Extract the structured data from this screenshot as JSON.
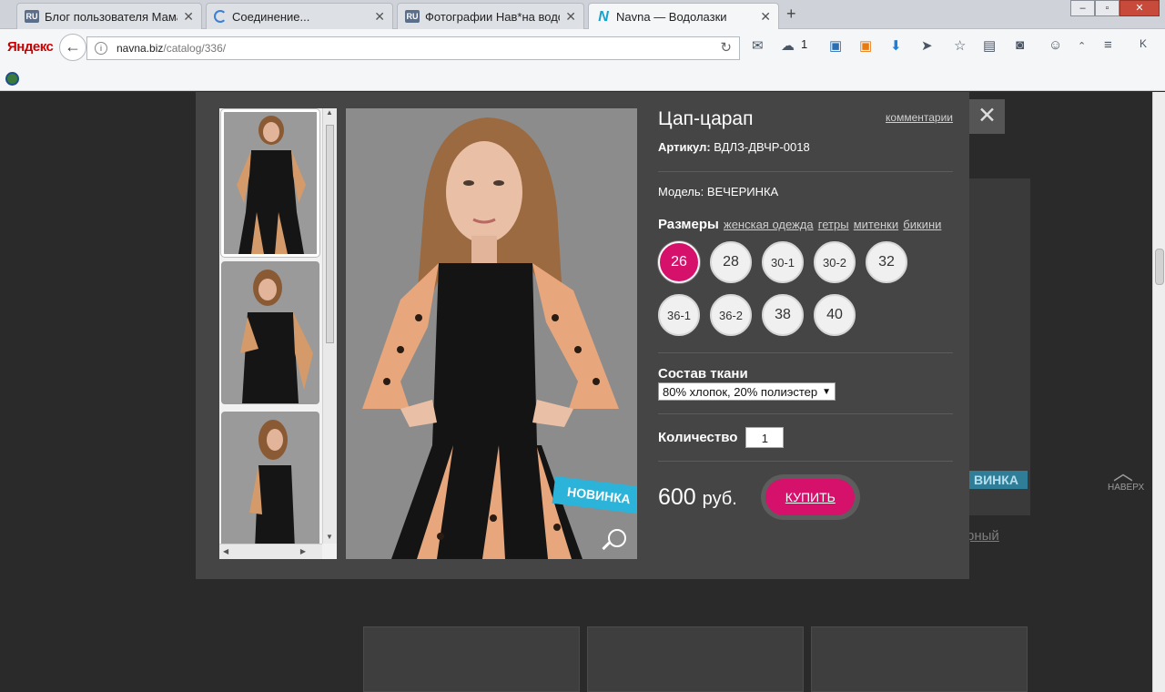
{
  "browser": {
    "tabs": [
      {
        "favicon": "RU",
        "title": "Блог пользователя Мама ..."
      },
      {
        "favicon": "loading-spinner",
        "title": "Соединение..."
      },
      {
        "favicon": "RU",
        "title": "Фотографии Нав*на водо..."
      },
      {
        "favicon": "N",
        "title": "Navna — Водолазки"
      }
    ],
    "new_tab": "+",
    "logo": "Яндекс",
    "url_host": "navna.biz",
    "url_path": "/catalog/336/",
    "cloud_count": "1",
    "window_controls": {
      "minimize": "‒",
      "maximize": "▫",
      "close": "✕"
    }
  },
  "page": {
    "scroll_up_label": "НАВЕРХ",
    "bg_link": "рный",
    "bg_badge": "ВИНКА"
  },
  "product": {
    "title": "Цап-царап",
    "comments_link": "комментарии",
    "article_label": "Артикул:",
    "article_value": "ВДЛЗ-ДВЧР-0018",
    "model_label": "Модель:",
    "model_value": "ВЕЧЕРИНКА",
    "sizes_label": "Размеры",
    "size_links": [
      "женская одежда",
      "гетры",
      "митенки",
      "бикини"
    ],
    "sizes": [
      "26",
      "28",
      "30-1",
      "30-2",
      "32",
      "36-1",
      "36-2",
      "38",
      "40"
    ],
    "selected_size": "26",
    "fabric_label": "Состав ткани",
    "fabric_value": "80% хлопок, 20% полиэстер",
    "quantity_label": "Количество",
    "quantity_value": "1",
    "price": "600",
    "currency": "руб.",
    "buy_label": "КУПИТЬ",
    "badge": "НОВИНКА",
    "close_icon": "✕"
  },
  "colors": {
    "accent": "#d5116c",
    "badge": "#2bb3d9",
    "modal_bg": "#454545"
  }
}
